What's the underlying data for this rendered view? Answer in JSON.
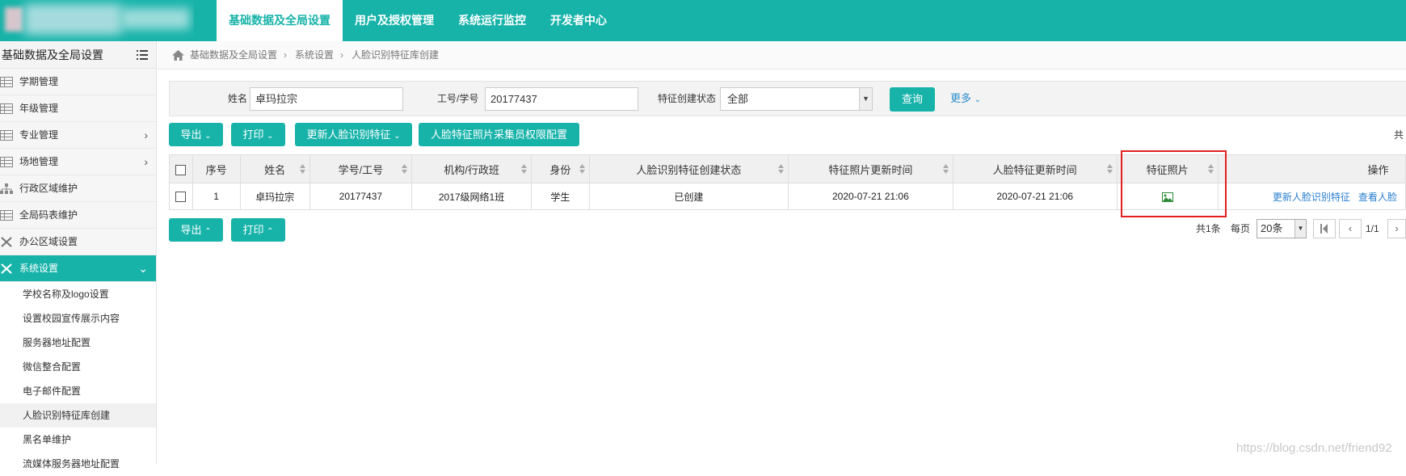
{
  "topnav": {
    "items": [
      "基础数据及全局设置",
      "用户及授权管理",
      "系统运行监控",
      "开发者中心"
    ]
  },
  "sidebar": {
    "title": "基础数据及全局设置",
    "items": [
      {
        "label": "学期管理",
        "icon": "table-icon"
      },
      {
        "label": "年级管理",
        "icon": "table-icon"
      },
      {
        "label": "专业管理",
        "icon": "table-icon"
      },
      {
        "label": "场地管理",
        "icon": "table-icon"
      },
      {
        "label": "行政区域维护",
        "icon": "org-tree-icon"
      },
      {
        "label": "全局码表维护",
        "icon": "table-icon"
      },
      {
        "label": "办公区域设置",
        "icon": "wrench-icon"
      },
      {
        "label": "系统设置",
        "icon": "wrench-icon"
      }
    ],
    "subitems": [
      "学校名称及logo设置",
      "设置校园宣传展示内容",
      "服务器地址配置",
      "微信整合配置",
      "电子邮件配置",
      "人脸识别特征库创建",
      "黑名单维护",
      "流媒体服务器地址配置"
    ]
  },
  "breadcrumb": [
    "基础数据及全局设置",
    "系统设置",
    "人脸识别特征库创建"
  ],
  "filters": {
    "name_label": "姓名",
    "name_value": "卓玛拉宗",
    "id_label": "工号/学号",
    "id_value": "20177437",
    "status_label": "特征创建状态",
    "status_value": "全部",
    "query_label": "查询",
    "more_label": "更多"
  },
  "toolbar": {
    "export_label": "导出",
    "print_label": "打印",
    "update_label": "更新人脸识别特征",
    "perm_label": "人脸特征照片采集员权限配置",
    "total_prefix": "共"
  },
  "table": {
    "headers": [
      "序号",
      "姓名",
      "学号/工号",
      "机构/行政班",
      "身份",
      "人脸识别特征创建状态",
      "特征照片更新时间",
      "人脸特征更新时间",
      "特征照片",
      "操作"
    ],
    "rows": [
      {
        "index": "1",
        "name": "卓玛拉宗",
        "number": "20177437",
        "org": "2017级网络1班",
        "role": "学生",
        "status": "已创建",
        "photo_time": "2020-07-21 21:06",
        "feature_time": "2020-07-21 21:06",
        "photo_icon": "image-icon",
        "op1": "更新人脸识别特征",
        "op2": "查看人脸"
      }
    ]
  },
  "pager": {
    "total": "共1条",
    "per_page_label": "每页",
    "per_page_value": "20条",
    "page": "1/1"
  },
  "watermark": "https://blog.csdn.net/friend92",
  "colors": {
    "accent": "#17b3a9",
    "link": "#2a7fd0",
    "highlight_box": "#e31f1f"
  }
}
